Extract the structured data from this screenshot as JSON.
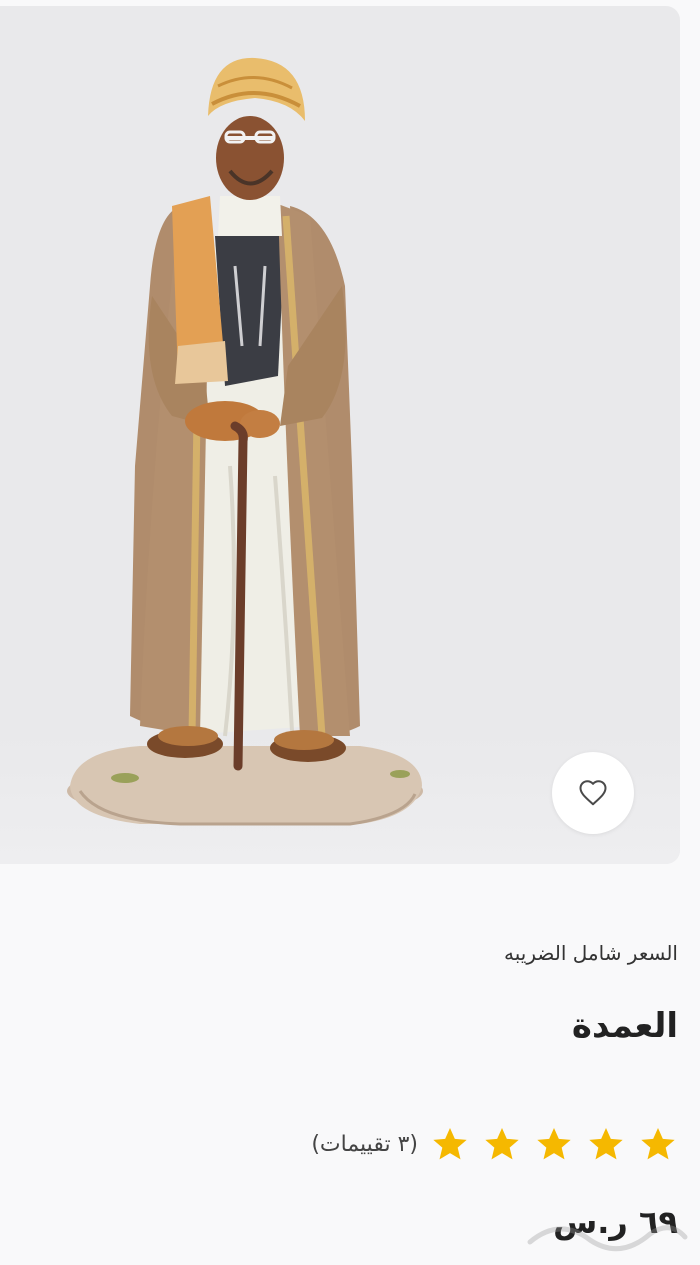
{
  "product": {
    "tax_note": "السعر شامل الضريبه",
    "title": "العمدة",
    "rating": {
      "stars": 5,
      "max": 5,
      "count_label": "(٣ تقييمات)"
    },
    "price": "٦٩ ر.س"
  },
  "icons": {
    "wishlist": "heart-outline-icon",
    "rating": "star-icon"
  },
  "colors": {
    "star": "#f5b800",
    "background": "#f9f9fa",
    "image_background": "#e9e9eb"
  }
}
